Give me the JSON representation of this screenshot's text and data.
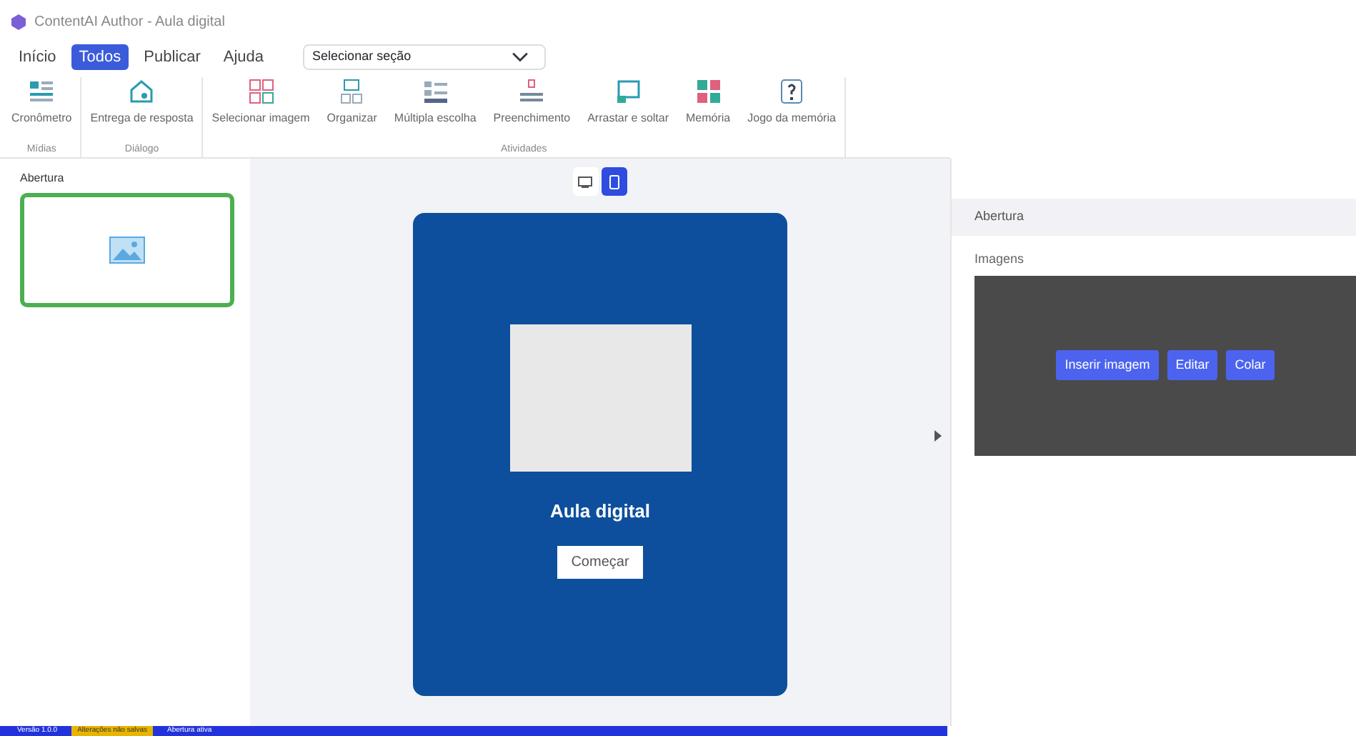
{
  "window": {
    "title": "ContentAI Author - Aula digital"
  },
  "menu": [
    {
      "label": "Início",
      "selected": false
    },
    {
      "label": "Todos",
      "selected": true
    },
    {
      "label": "Publicar",
      "selected": false
    },
    {
      "label": "Ajuda",
      "selected": false
    }
  ],
  "section_select": {
    "value": "Selecionar seção"
  },
  "ribbon": [
    {
      "label": "Mídias",
      "tools": [
        {
          "label": "Cronômetro",
          "kind": "chart"
        }
      ]
    },
    {
      "label": "Diálogo",
      "tools": [
        {
          "label": "Entrega de resposta",
          "kind": "home"
        }
      ]
    },
    {
      "label": "Atividades",
      "tools": [
        {
          "label": "Selecionar imagem",
          "kind": "grid"
        },
        {
          "label": "Organizar",
          "kind": "stack"
        },
        {
          "label": "Múltipla escolha",
          "kind": "list"
        },
        {
          "label": "Preenchimento",
          "kind": "blanks"
        },
        {
          "label": "Arrastar e soltar",
          "kind": "screen"
        },
        {
          "label": "Memória",
          "kind": "tiles"
        },
        {
          "label": "Jogo da memória",
          "kind": "question"
        }
      ]
    }
  ],
  "slides": {
    "title": "Abertura",
    "items": [
      {
        "selected": true
      }
    ]
  },
  "device_toggle": [
    {
      "kind": "desktop",
      "selected": false
    },
    {
      "kind": "mobile",
      "selected": true
    }
  ],
  "preview": {
    "title": "Aula digital",
    "button": "Começar"
  },
  "panel": {
    "title": "Abertura",
    "section": "Imagens",
    "buttons": [
      "Inserir imagem",
      "Editar",
      "Colar"
    ]
  },
  "status_bar": [
    {
      "text": "Versão 1.0.0",
      "kind": "info"
    },
    {
      "text": "Alterações não salvas",
      "kind": "warning"
    },
    {
      "text": "Abertura ativa",
      "kind": "info"
    }
  ]
}
